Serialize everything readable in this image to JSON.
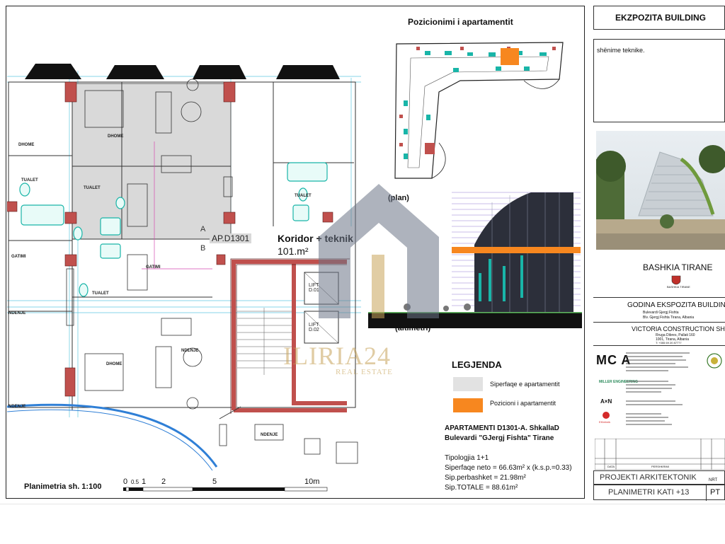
{
  "title_block": {
    "project_name": "EKZPOZITA BUILDING",
    "notes_label": "shënime teknike.",
    "municipality": "BASHKIA TIRANE",
    "seal_text": "BASHKIA TIRANE",
    "building_name": "GODINA EKSPOZITA BUILDING",
    "building_address": "Bulevardi Gjergj Fishta",
    "building_address_2": "Blv. Gjergj Fishta Tirana, Albania",
    "developer": "VICTORIA CONSTRUCTION SH.P.K",
    "developer_address": "Rruga Dibres, Pallati 160",
    "developer_city": "1001, Tirana, Albania",
    "developer_phone": "T: +355 69 20 87777",
    "logo_mca": "MC A",
    "logo_eng": "MILLER ENGINEERING",
    "logo_axn": "A×N",
    "logo_ek": "EKtebnik",
    "drawing_type": "PROJEKTI ARKITEKTONIK",
    "drawing_code": "NRT",
    "drawing_title": "PLANIMETRI KATI +13",
    "drawing_phase": "PT",
    "date_label": "DATA",
    "revision_label": "PERSHKRIMI"
  },
  "plan": {
    "apartment_tag": "AP.D1301",
    "corridor_label": "Koridor + teknik",
    "corridor_area": "101.m²",
    "scale_label": "Planimetria sh. 1:100",
    "scale_ticks": [
      "0",
      "0.5",
      "1",
      "2",
      "5",
      "10m"
    ],
    "rooms": {
      "dhome": "DHOME",
      "tualet": "TUALET",
      "gatimi": "GATIMI",
      "ndenje": "NDENJE"
    },
    "lift_1": "LIFT D.01",
    "lift_2": "LIFT D.02",
    "section_a": "A",
    "section_b": "B"
  },
  "position": {
    "title": "Pozicionimi i apartamentit",
    "plan_caption": "(plan)",
    "elevation_caption": "(altimetri)"
  },
  "legend": {
    "title": "LEGJENDA",
    "items": [
      {
        "label": "Siperfaqe e apartamentit",
        "color": "#e2e2e2"
      },
      {
        "label": "Pozicioni i  apartamentit",
        "color": "#f7871f"
      }
    ]
  },
  "apartment_info": {
    "name_line": "APARTAMENTI D1301-A. ShkallaD",
    "address_line": "Bulevardi \"GJergj Fishta\" Tirane",
    "typology": "Tipologjia 1+1",
    "net_area": "Siperfaqe neto = 66.63m² x (k.s.p.=0.33)",
    "shared_area": "Sip.perbashket = 21.98m²",
    "total_area": "Sip.TOTALE = 88.61m²"
  },
  "watermark": {
    "brand": "ILIRIA24",
    "sub": "REAL ESTATE"
  },
  "colors": {
    "orange": "#f7871f",
    "cyan": "#19b5a8",
    "wall_red": "#c0504d",
    "gray_fill": "#d9d9d9",
    "magenta": "#d44ab0"
  }
}
